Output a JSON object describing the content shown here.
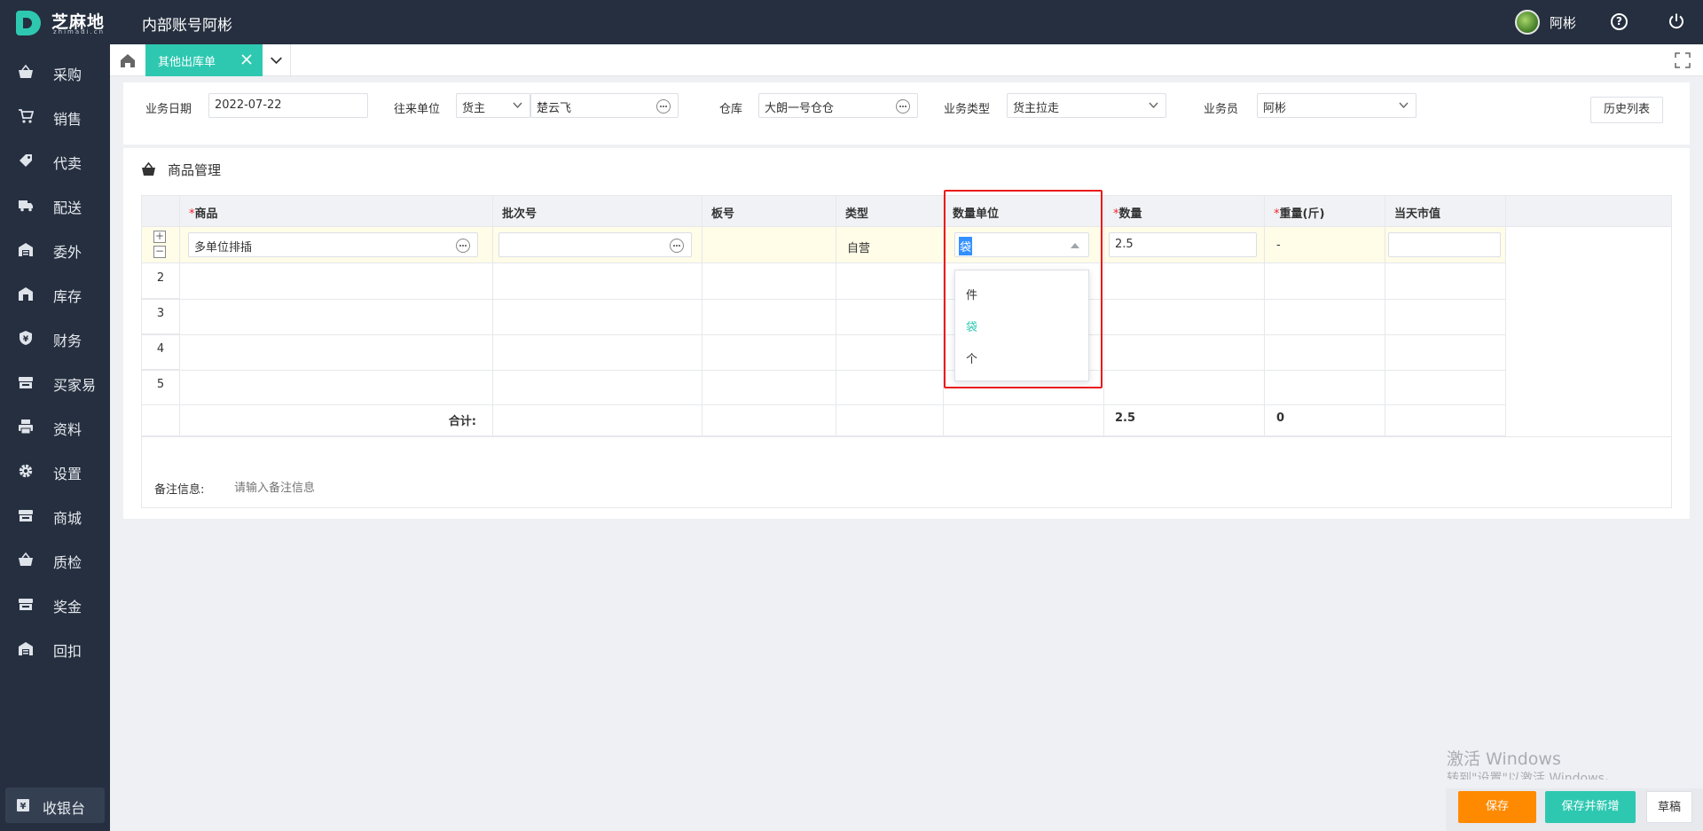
{
  "header": {
    "logo_name": "芝麻地",
    "logo_sub": "zhimadi.cn",
    "account_title": "内部账号阿彬",
    "user_name": "阿彬"
  },
  "sidebar": {
    "items": [
      {
        "label": "采购",
        "icon": "basket-icon"
      },
      {
        "label": "销售",
        "icon": "cart-icon"
      },
      {
        "label": "代卖",
        "icon": "tag-icon"
      },
      {
        "label": "配送",
        "icon": "truck-icon"
      },
      {
        "label": "委外",
        "icon": "warehouse-icon"
      },
      {
        "label": "库存",
        "icon": "store-icon"
      },
      {
        "label": "财务",
        "icon": "yen-shield-icon"
      },
      {
        "label": "买家易",
        "icon": "shop-icon"
      },
      {
        "label": "资料",
        "icon": "printer-icon"
      },
      {
        "label": "设置",
        "icon": "gear-icon"
      },
      {
        "label": "商城",
        "icon": "shop-icon"
      },
      {
        "label": "质检",
        "icon": "basket-icon"
      },
      {
        "label": "奖金",
        "icon": "shop-icon"
      },
      {
        "label": "回扣",
        "icon": "warehouse-icon"
      }
    ],
    "cashier_label": "收银台"
  },
  "tabs": {
    "active_label": "其他出库单"
  },
  "filters": {
    "date_label": "业务日期",
    "date_value": "2022-07-22",
    "partner_label": "往来单位",
    "partner_type": "货主",
    "partner_name": "楚云飞",
    "warehouse_label": "仓库",
    "warehouse_value": "大朗一号仓仓",
    "biz_type_label": "业务类型",
    "biz_type_value": "货主拉走",
    "salesman_label": "业务员",
    "salesman_value": "阿彬",
    "history_button": "历史列表"
  },
  "goods": {
    "section_title": "商品管理",
    "columns": [
      "商品",
      "批次号",
      "板号",
      "类型",
      "数量单位",
      "数量",
      "重量(斤)",
      "当天市值"
    ],
    "required_mark": "*",
    "row1": {
      "product": "多单位排插",
      "batch": "",
      "type": "自营",
      "unit": "袋",
      "quantity": "2.5",
      "weight": "-",
      "market_value": ""
    },
    "row_numbers": [
      "2",
      "3",
      "4",
      "5"
    ],
    "plus_symbol": "+",
    "minus_symbol": "−",
    "total_label": "合计:",
    "total_quantity": "2.5",
    "total_weight": "0",
    "remark_label": "备注信息:",
    "remark_placeholder": "请输入备注信息"
  },
  "unit_dropdown": {
    "options": [
      "件",
      "袋",
      "个"
    ],
    "selected": "袋"
  },
  "watermark": {
    "line1": "激活 Windows",
    "line2": "转到\"设置\"以激活 Windows。"
  },
  "actions": {
    "save": "保存",
    "save_and_new": "保存并新增",
    "draft": "草稿"
  },
  "colors": {
    "accent": "#2ec8b1",
    "sidebar_bg": "#252f3f",
    "save_button": "#ff8a00",
    "required": "#f5222d",
    "highlight": "#ea1b1b"
  }
}
